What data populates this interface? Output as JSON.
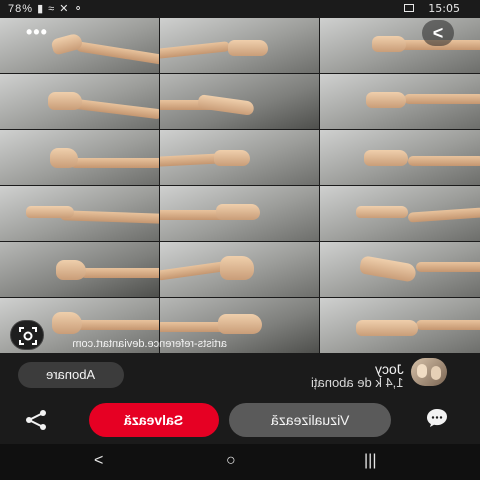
{
  "status_bar": {
    "time": "15:05",
    "left_text": "78% ▮ ≈ ✕ ⚬"
  },
  "overlay": {
    "menu_dots": "•••",
    "back_glyph": "<",
    "lens_icon": "lens-icon",
    "source_url": "artists-reference.deviantart.com"
  },
  "creator": {
    "name": "Jocy",
    "followers": "1,4 k de abonați",
    "follow_label": "Abonare"
  },
  "actions": {
    "visit_label": "Vizualizează",
    "save_label": "Salvează",
    "share_icon": "share-icon",
    "comment_icon": "comment-icon"
  },
  "navigation": {
    "back": "<",
    "home": "○",
    "recent": "|||"
  },
  "colors": {
    "save_red": "#e60023",
    "visit_gray": "#5a5a5a",
    "background": "#1b1b1b"
  }
}
